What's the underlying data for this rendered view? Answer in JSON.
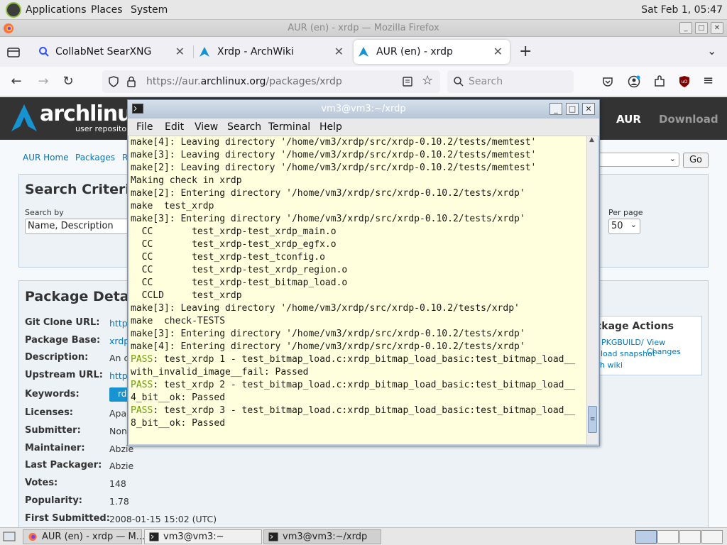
{
  "top_panel": {
    "menus": [
      "Applications",
      "Places",
      "System"
    ],
    "clock": "Sat Feb 1, 05:47"
  },
  "firefox": {
    "window_title": "AUR (en) - xrdp — Mozilla Firefox",
    "tabs": [
      {
        "label": "CollabNet SearXNG",
        "icon": "magnifier-icon",
        "active": false
      },
      {
        "label": "Xrdp - ArchWiki",
        "icon": "arch-icon",
        "active": false
      },
      {
        "label": "AUR (en) - xrdp",
        "icon": "arch-icon",
        "active": true
      }
    ],
    "url_prefix": "https://aur.",
    "url_domain": "archlinux.org",
    "url_path": "/packages/xrdp",
    "search_placeholder": "Search"
  },
  "arch_page": {
    "logo_word": "archlinux",
    "logo_sub": "user repository",
    "nav": [
      "AUR",
      "Download"
    ],
    "breadcrumbs": [
      "AUR Home",
      "Packages",
      "R"
    ],
    "go_button": "Go",
    "search_criteria": {
      "heading": "Search Criteria",
      "search_by_label": "Search by",
      "search_by_value": "Name, Description",
      "per_page_label": "Per page",
      "per_page_value": "50"
    },
    "package_details": {
      "heading": "Package Details",
      "rows": [
        {
          "label": "Git Clone URL:",
          "value": "https"
        },
        {
          "label": "Package Base:",
          "value": "xrdp"
        },
        {
          "label": "Description:",
          "value": "An c"
        },
        {
          "label": "Upstream URL:",
          "value": "https"
        },
        {
          "label": "Keywords:",
          "value": "rd"
        },
        {
          "label": "Licenses:",
          "value": "Apac"
        },
        {
          "label": "Submitter:",
          "value": "Non"
        },
        {
          "label": "Maintainer:",
          "value": "Abzie"
        },
        {
          "label": "Last Packager:",
          "value": "Abzie"
        },
        {
          "label": "Votes:",
          "value": "148"
        },
        {
          "label": "Popularity:",
          "value": "1.78"
        },
        {
          "label": "First Submitted:",
          "value": "2008-01-15 15:02 (UTC)"
        }
      ]
    },
    "package_actions": {
      "heading": "ckage Actions",
      "links": [
        "PKGBUILD",
        "View Changes",
        "nload snapshot",
        "ch wiki"
      ]
    }
  },
  "terminal": {
    "title": "vm3@vm3:~/xrdp",
    "menu": [
      "File",
      "Edit",
      "View",
      "Search",
      "Terminal",
      "Help"
    ],
    "lines": [
      {
        "pass": "",
        "text": "make[4]: Leaving directory '/home/vm3/xrdp/src/xrdp-0.10.2/tests/memtest'"
      },
      {
        "pass": "",
        "text": "make[3]: Leaving directory '/home/vm3/xrdp/src/xrdp-0.10.2/tests/memtest'"
      },
      {
        "pass": "",
        "text": "make[2]: Leaving directory '/home/vm3/xrdp/src/xrdp-0.10.2/tests/memtest'"
      },
      {
        "pass": "",
        "text": "Making check in xrdp"
      },
      {
        "pass": "",
        "text": "make[2]: Entering directory '/home/vm3/xrdp/src/xrdp-0.10.2/tests/xrdp'"
      },
      {
        "pass": "",
        "text": "make  test_xrdp"
      },
      {
        "pass": "",
        "text": "make[3]: Entering directory '/home/vm3/xrdp/src/xrdp-0.10.2/tests/xrdp'"
      },
      {
        "pass": "",
        "text": "  CC       test_xrdp-test_xrdp_main.o"
      },
      {
        "pass": "",
        "text": "  CC       test_xrdp-test_xrdp_egfx.o"
      },
      {
        "pass": "",
        "text": "  CC       test_xrdp-test_tconfig.o"
      },
      {
        "pass": "",
        "text": "  CC       test_xrdp-test_xrdp_region.o"
      },
      {
        "pass": "",
        "text": "  CC       test_xrdp-test_bitmap_load.o"
      },
      {
        "pass": "",
        "text": "  CCLD     test_xrdp"
      },
      {
        "pass": "",
        "text": "make[3]: Leaving directory '/home/vm3/xrdp/src/xrdp-0.10.2/tests/xrdp'"
      },
      {
        "pass": "",
        "text": "make  check-TESTS"
      },
      {
        "pass": "",
        "text": "make[3]: Entering directory '/home/vm3/xrdp/src/xrdp-0.10.2/tests/xrdp'"
      },
      {
        "pass": "",
        "text": "make[4]: Entering directory '/home/vm3/xrdp/src/xrdp-0.10.2/tests/xrdp'"
      },
      {
        "pass": "PASS",
        "text": ": test_xrdp 1 - test_bitmap_load.c:xrdp_bitmap_load_basic:test_bitmap_load__"
      },
      {
        "pass": "",
        "text": "with_invalid_image__fail: Passed"
      },
      {
        "pass": "PASS",
        "text": ": test_xrdp 2 - test_bitmap_load.c:xrdp_bitmap_load_basic:test_bitmap_load__"
      },
      {
        "pass": "",
        "text": "4_bit__ok: Passed"
      },
      {
        "pass": "PASS",
        "text": ": test_xrdp 3 - test_bitmap_load.c:xrdp_bitmap_load_basic:test_bitmap_load__"
      },
      {
        "pass": "",
        "text": "8_bit__ok: Passed"
      }
    ]
  },
  "taskbar": {
    "items": [
      {
        "label": "AUR (en) - xrdp — M...",
        "icon": "firefox-icon"
      },
      {
        "label": "vm3@vm3:~",
        "icon": "terminal-icon"
      },
      {
        "label": "vm3@vm3:~/xrdp",
        "icon": "terminal-icon"
      }
    ]
  },
  "colors": {
    "terminal_bg": "#ffffdd",
    "pass_green": "#6aa000",
    "arch_blue": "#1793d1",
    "arch_header": "#333333",
    "link": "#0077bb"
  }
}
